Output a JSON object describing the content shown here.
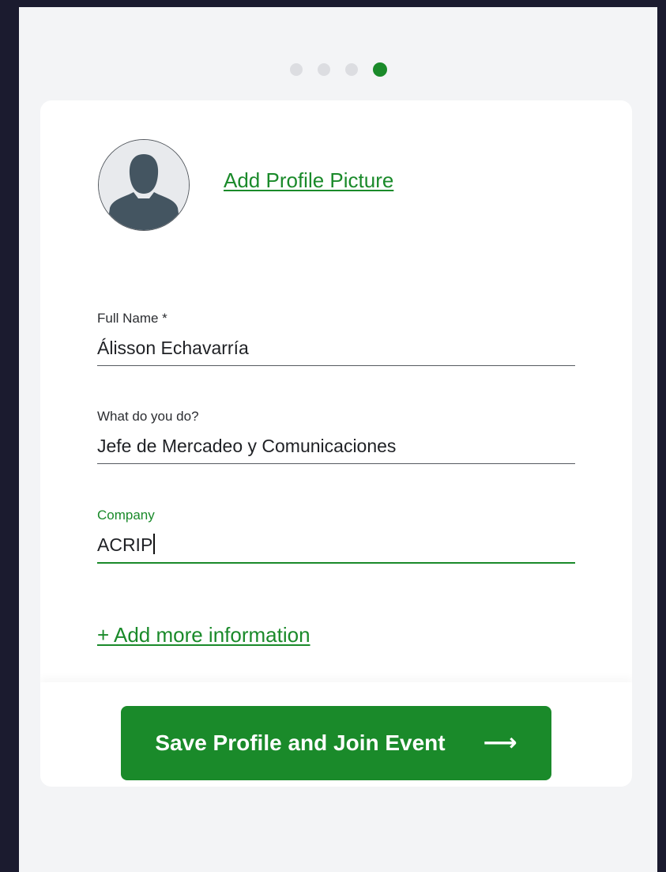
{
  "stepper": {
    "total_steps": 4,
    "current_step": 4
  },
  "profile": {
    "avatar_icon": "user-silhouette-icon",
    "add_picture_label": "Add Profile Picture"
  },
  "fields": {
    "full_name": {
      "label": "Full Name *",
      "value": "Álisson Echavarría"
    },
    "role": {
      "label": "What do you do?",
      "value": "Jefe de Mercadeo y Comunicaciones"
    },
    "company": {
      "label": "Company",
      "value": "ACRIP"
    }
  },
  "add_more_label": "+ Add more information",
  "save_button": {
    "label": "Save Profile and Join Event",
    "icon": "arrow-right-icon",
    "glyph": "⟶"
  },
  "colors": {
    "accent": "#1a8a2a",
    "outer_background": "#1b1b2f",
    "panel_background": "#f3f4f6",
    "card_background": "#ffffff",
    "inactive_dot": "#dcdde1"
  }
}
